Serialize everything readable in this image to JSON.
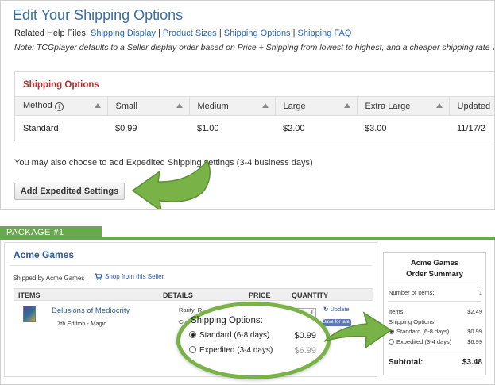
{
  "shipping_page": {
    "title": "Edit Your Shipping Options",
    "help_label": "Related Help Files:",
    "help_links": [
      "Shipping Display",
      "Product Sizes",
      "Shipping Options",
      "Shipping FAQ"
    ],
    "note": "Note: TCGplayer defaults to a Seller display order based on Price + Shipping from lowest to highest, and a cheaper shipping rate w",
    "box_title": "Shipping Options",
    "columns": [
      "Method",
      "Small",
      "Medium",
      "Large",
      "Extra Large",
      "Updated"
    ],
    "row": {
      "method": "Standard",
      "small": "$0.99",
      "medium": "$1.00",
      "large": "$2.00",
      "extra_large": "$3.00",
      "updated": "11/17/2"
    },
    "expedited_text": "You may also choose to add Expedited Shipping settings (3-4 business days)",
    "add_button": "Add Expedited Settings"
  },
  "package": {
    "tab_label": "PACKAGE #1",
    "seller_name": "Acme Games",
    "shipped_by": "Shipped by Acme Games",
    "shop_link": "Shop from this Seller",
    "headers": [
      "ITEMS",
      "DETAILS",
      "PRICE",
      "QUANTITY"
    ],
    "item": {
      "name": "Delusions of Mediocrity",
      "edition": "7th Edition - Magic",
      "rarity": "Rarity: R",
      "condition": "Condition: N",
      "quantity": "1",
      "update": "Update",
      "save": "Save for later"
    }
  },
  "callout": {
    "title": "Shipping Options:",
    "options": [
      {
        "label": "Standard (6-8 days)",
        "price": "$0.99",
        "selected": true
      },
      {
        "label": "Expedited (3-4 days)",
        "price": "$6.99",
        "selected": false
      }
    ]
  },
  "summary": {
    "title_line1": "Acme Games",
    "title_line2": "Order Summary",
    "items_count_label": "Number of Items:",
    "items_count": "1",
    "items_label": "Items:",
    "items_value": "$2.49",
    "shipping_label": "Shipping Options",
    "standard_label": "Standard (6-8 days)",
    "standard_value": "$0.99",
    "expedited_label": "Expedited (3-4 days)",
    "expedited_value": "$6.99",
    "subtotal_label": "Subtotal:",
    "subtotal_value": "$3.48"
  },
  "colors": {
    "accent_green": "#6aa84f",
    "link_blue": "#2a66b8",
    "title_red": "#b03030",
    "arrow_green": "#79b347"
  }
}
